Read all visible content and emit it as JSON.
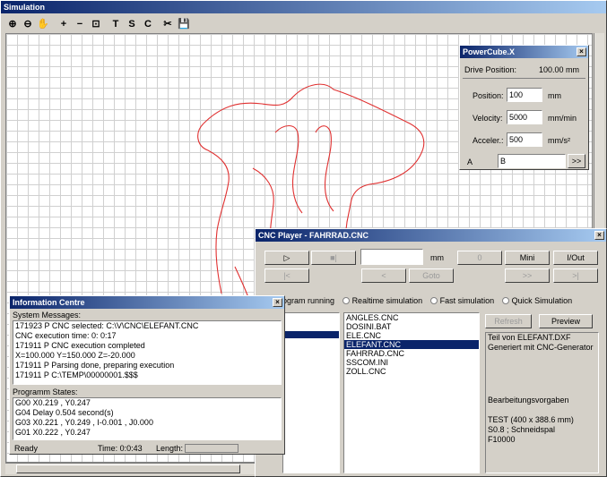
{
  "sim": {
    "title": "Simulation",
    "toolbar": [
      "⊕",
      "⊖",
      "✋",
      "+",
      "−",
      "⊡",
      "T",
      "S",
      "C",
      "✂",
      "💾"
    ]
  },
  "pc": {
    "title": "PowerCube.X",
    "drive_label": "Drive Position:",
    "drive_value": "100.00 mm",
    "position_label": "Position:",
    "position_value": "100",
    "position_unit": "mm",
    "velocity_label": "Velocity:",
    "velocity_value": "5000",
    "velocity_unit": "mm/min",
    "accel_label": "Acceler.:",
    "accel_value": "500",
    "accel_unit": "mm/s²",
    "a_label": "A",
    "b_label": "B",
    "more": ">>"
  },
  "cnc": {
    "title": "CNC Player - FAHRRAD.CNC",
    "play": "▷",
    "stop": "■|",
    "mm": "mm",
    "mini": "Mini",
    "io": "I/Out",
    "goto": "Goto",
    "modes": [
      "ogram running",
      "Realtime simulation",
      "Fast simulation",
      "Quick Simulation"
    ],
    "files": [
      "ANGLES.CNC",
      "DOSINI.BAT",
      "ELE.CNC",
      "ELEFANT.CNC",
      "FAHRRAD.CNC",
      "SSCOM.INI",
      "ZOLL.CNC"
    ],
    "refresh": "Refresh",
    "preview": "Preview",
    "info": [
      "Teil von ELEFANT.DXF",
      "Generiert mit CNC-Generator"
    ],
    "info2": [
      "Bearbeitungsvorgaben",
      "",
      "TEST (400 x 388.6 mm)",
      "S0.8      ; Schneidspal",
      "F10000"
    ]
  },
  "ic": {
    "title": "Information Centre",
    "sys_label": "System Messages:",
    "messages": [
      "171923 P    CNC selected: C:\\V\\CNC\\ELEFANT.CNC",
      "             CNC execution time:  0: 0:17",
      "171911 P    CNC execution completed",
      "             X=100.000 Y=150.000 Z=-20.000",
      "171911 P    Parsing done, preparing execution",
      "171911 P    C:\\TEMP\\00000001.$$$"
    ],
    "prog_label": "Programm States:",
    "states": [
      "G00 X0.219 , Y0.247",
      "G04 Delay 0.504 second(s)",
      "G03 X0.221 , Y0.249 , I-0.001 , J0.000",
      "G01 X0.222 , Y0.247"
    ],
    "status": "Ready",
    "time": "Time: 0:0:43",
    "length": "Length:"
  },
  "colors": {
    "title_start": "#0a246a",
    "title_end": "#a6caf0",
    "drawing": "#e03030",
    "grid": "#c8c8c8"
  }
}
